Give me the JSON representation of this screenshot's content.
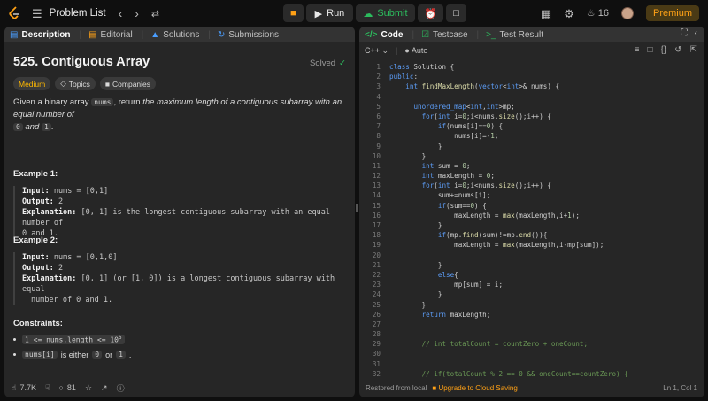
{
  "topbar": {
    "problem_list": "Problem List",
    "run": "Run",
    "submit": "Submit",
    "streak": "16",
    "premium": "Premium"
  },
  "left_tabs": [
    "Description",
    "Editorial",
    "Solutions",
    "Submissions"
  ],
  "problem": {
    "title": "525. Contiguous Array",
    "status": "Solved",
    "difficulty": "Medium",
    "topics": "Topics",
    "companies": "Companies",
    "statement_a": "Given a binary array ",
    "statement_code": "nums",
    "statement_b": ", return ",
    "statement_em": "the maximum length of a contiguous subarray with an equal number of",
    "statement_c": " and ",
    "zero": "0",
    "one": "1",
    "period": "."
  },
  "examples": [
    {
      "title": "Example 1:",
      "input_label": "Input:",
      "input": "nums = [0,1]",
      "output_label": "Output:",
      "output": "2",
      "expl_label": "Explanation:",
      "expl1": "[0, 1] is the longest contiguous subarray with an equal number of",
      "expl2": "0 and 1."
    },
    {
      "title": "Example 2:",
      "input_label": "Input:",
      "input": "nums = [0,1,0]",
      "output_label": "Output:",
      "output": "2",
      "expl_label": "Explanation:",
      "expl1": "[0, 1] (or [1, 0]) is a longest contiguous subarray with equal",
      "expl2": "number of 0 and 1."
    }
  ],
  "constraints": {
    "title": "Constraints:",
    "c1_code": "1 <= nums.length <= 10",
    "c1_sup": "5",
    "c2_code": "nums[i]",
    "c2_text": " is either ",
    "c2_zero": "0",
    "c2_or": " or ",
    "c2_one": "1",
    "c2_end": "."
  },
  "left_footer": {
    "likes": "7.7K",
    "comments": "81"
  },
  "right_tabs": [
    "Code",
    "Testcase",
    "Test Result"
  ],
  "editor": {
    "language": "C++",
    "mode": "Auto"
  },
  "code_lines": [
    "class Solution {",
    "public:",
    "    int findMaxLength(vector<int>& nums) {",
    "",
    "      unordered_map<int,int>mp;",
    "        for(int i=0;i<nums.size();i++) {",
    "            if(nums[i]==0) {",
    "                nums[i]=-1;",
    "            }",
    "        }",
    "        int sum = 0;",
    "        int maxLength = 0;",
    "        for(int i=0;i<nums.size();i++) {",
    "            sum+=nums[i];",
    "            if(sum==0) {",
    "                maxLength = max(maxLength,i+1);",
    "            }",
    "            if(mp.find(sum)!=mp.end()){",
    "                maxLength = max(maxLength,i-mp[sum]);",
    "",
    "            }",
    "            else{",
    "                mp[sum] = i;",
    "            }",
    "        }",
    "        return maxLength;",
    "",
    "",
    "        // int totalCount = countZero + oneCount;",
    "",
    "",
    "        // if(totalCount % 2 == 0 && oneCount==countZero) {"
  ],
  "right_footer": {
    "restored": "Restored from local",
    "upgrade": "Upgrade to Cloud Saving",
    "position": "Ln 1, Col 1"
  }
}
